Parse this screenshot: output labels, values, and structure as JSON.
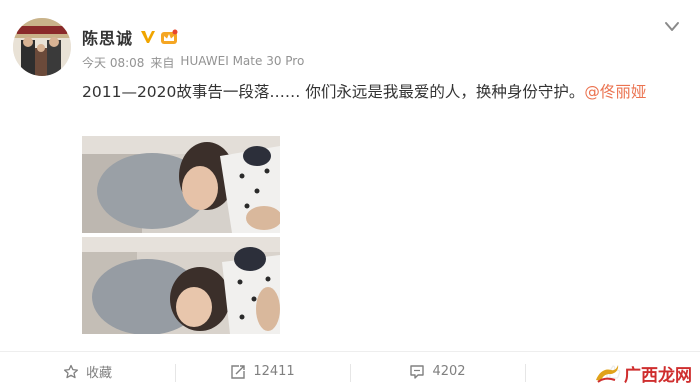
{
  "post": {
    "author": "陈思诚",
    "time": "今天 08:08",
    "source_prefix": "来自",
    "source_device": "HUAWEI Mate 30 Pro",
    "text": "2011—2020故事告一段落…… 你们永远是我最爱的人，换种身份守护。",
    "mention": "@佟丽娅"
  },
  "actions": {
    "favorite_label": "收藏",
    "repost_count": "12411",
    "comment_count": "4202"
  },
  "watermark": {
    "text": "广西龙网"
  },
  "colors": {
    "mention": "#eb7350",
    "verified_badge": "#f0a500",
    "meta_text": "#939393",
    "watermark": "#cf2e2e"
  },
  "icons": {
    "verified": "verified-v-icon",
    "vip": "vip-crown-icon",
    "more": "chevron-down-icon",
    "favorite": "star-icon",
    "repost": "repost-icon",
    "comment": "comment-icon",
    "like": "thumbs-up-icon"
  }
}
